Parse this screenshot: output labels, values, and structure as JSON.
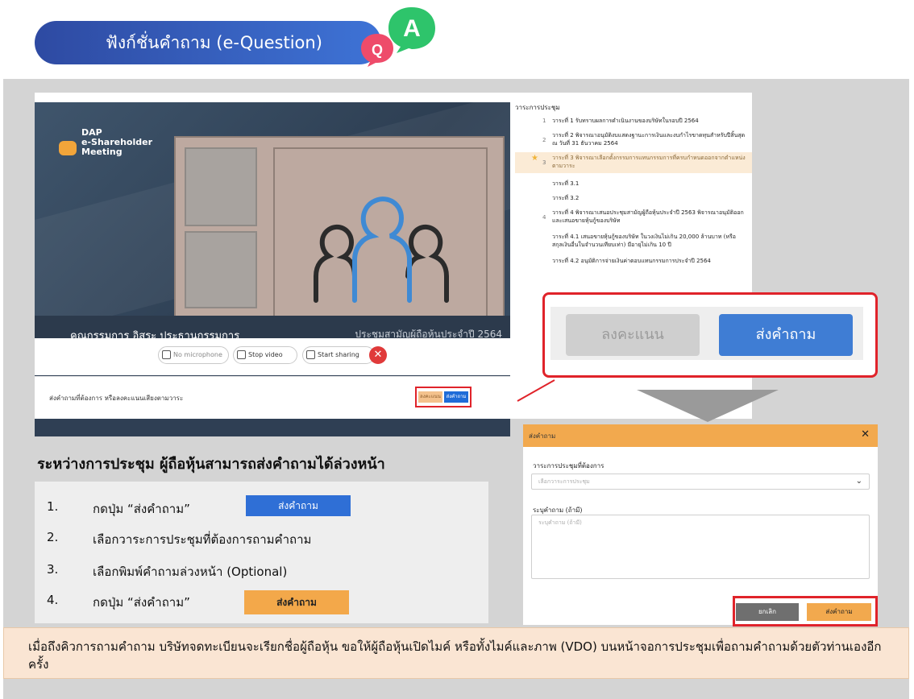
{
  "header": {
    "title": "ฟังก์ชั่นคำถาม (e-Question)",
    "qa_icon_a": "A",
    "qa_icon_q": "Q"
  },
  "video": {
    "logo_text": "DAP\ne-Shareholder\nMeeting",
    "caption_left": "คุณกรรมการ อิสระ ประธานกรรมการ",
    "caption_right": "ประชุมสามัญผู้ถือหุ้นประจำปี 2564"
  },
  "controls": {
    "mic": "No microphone",
    "video": "Stop video",
    "share": "Start sharing"
  },
  "footer": {
    "text": "ส่งคำถามที่ต้องการ หรือลงคะแนนเสียงตามวาระ",
    "vote": "ลงคะแนน",
    "send": "ส่งคำถาม"
  },
  "agenda": {
    "title": "วาระการประชุม",
    "items": [
      {
        "num": "1",
        "text": "วาระที่ 1 รับทราบผลการดำเนินงานของบริษัทในรอบปี 2564"
      },
      {
        "num": "2",
        "text": "วาระที่ 2 พิจารณาอนุมัติงบแสดงฐานะการเงินและงบกำไรขาดทุนสำหรับปีสิ้นสุด ณ วันที่ 31 ธันวาคม 2564"
      },
      {
        "num": "3",
        "text": "วาระที่ 3 พิจารณาเลือกตั้งกรรมการแทนกรรมการที่ครบกำหนดออกจากตำแหน่งตามวาระ"
      },
      {
        "num": "",
        "text": "วาระที่ 3.1"
      },
      {
        "num": "",
        "text": "วาระที่ 3.2"
      },
      {
        "num": "4",
        "text": "วาระที่ 4 พิจารณาเสนอประชุมสามัญผู้ถือหุ้นประจำปี 2563 พิจารณาอนุมัติออกและเสนอขายหุ้นกู้ของบริษัท"
      },
      {
        "num": "",
        "text": "วาระที่ 4.1 เสนอขายหุ้นกู้ของบริษัท ในวงเงินไม่เกิน 20,000 ล้านบาท (หรือสกุลเงินอื่นในจำนวนเทียบเท่า) มีอายุไม่เกิน 10 ปี"
      },
      {
        "num": "",
        "text": "วาระที่ 4.2 อนุมัติการจ่ายเงินค่าตอบแทนกรรมการประจำปี 2564"
      }
    ]
  },
  "zoom": {
    "vote": "ลงคะแนน",
    "send": "ส่งคำถาม"
  },
  "heading": "ระหว่างการประชุม ผู้ถือหุ้นสามารถส่งคำถามได้ล่วงหน้า",
  "steps": [
    {
      "n": "1.",
      "t": "กดปุ่ม “ส่งคำถาม”"
    },
    {
      "n": "2.",
      "t": "เลือกวาระการประชุมที่ต้องการถามคำถาม"
    },
    {
      "n": "3.",
      "t": "เลือกพิมพ์คำถามล่วงหน้า (Optional)"
    },
    {
      "n": "4.",
      "t": "กดปุ่ม “ส่งคำถาม”"
    }
  ],
  "inline_buttons": {
    "blue": "ส่งคำถาม",
    "orange": "ส่งคำถาม"
  },
  "dialog": {
    "title": "ส่งคำถาม",
    "label_agenda": "วาระการประชุมที่ต้องการ",
    "select_placeholder": "เลือกวาระการประชุม",
    "label_question": "ระบุคำถาม (ถ้ามี)",
    "textarea_placeholder": "ระบุคำถาม (ถ้ามี)",
    "cancel": "ยกเลิก",
    "send": "ส่งคำถาม"
  },
  "note": "เมื่อถึงคิวการถามคำถาม บริษัทจดทะเบียนจะเรียกชื่อผู้ถือหุ้น ขอให้ผู้ถือหุ้นเปิดไมค์ หรือทั้งไมค์และภาพ (VDO) บนหน้าจอการประชุมเพื่อถามคำถามด้วยตัวท่านเองอีกครั้ง",
  "colors": {
    "accent_blue": "#3f7dd4",
    "accent_orange": "#f2a94e",
    "highlight_red": "#e0232a"
  }
}
